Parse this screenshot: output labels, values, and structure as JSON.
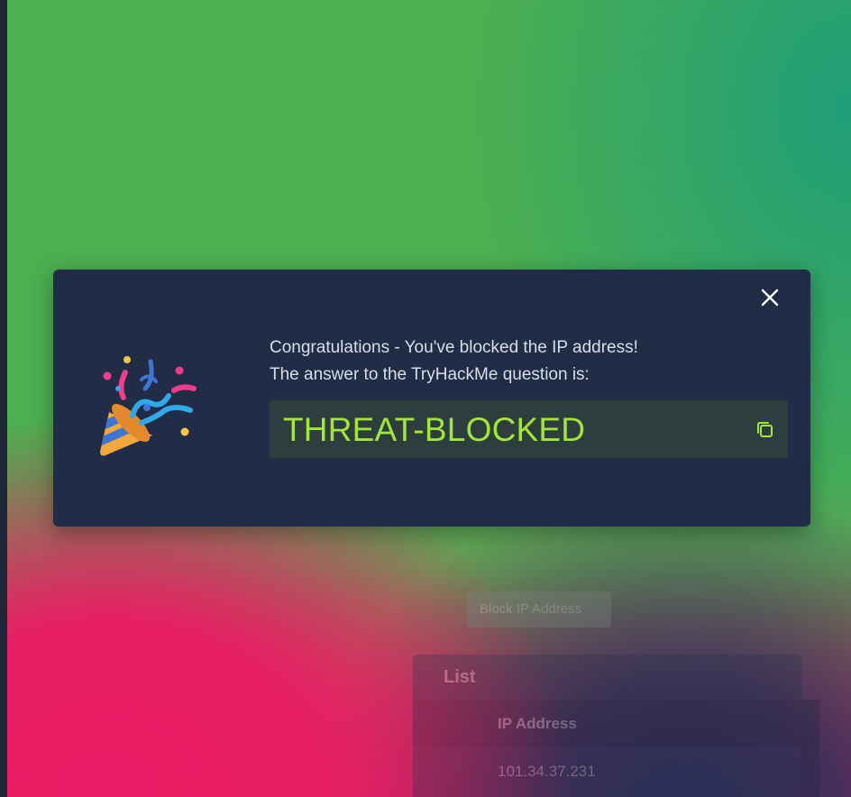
{
  "modal": {
    "message_line1": "Congratulations - You've blocked the IP address!",
    "message_line2": "The answer to the TryHackMe question is:",
    "answer": "THREAT-BLOCKED",
    "close_icon": "close-icon",
    "copy_icon": "copy-icon",
    "party_icon": "party-popper-icon",
    "answer_color": "#a3e635"
  },
  "background_page": {
    "block_button_label": "Block IP Address",
    "list_title": "List",
    "table_header": "IP Address",
    "rows": [
      "101.34.37.231"
    ]
  }
}
